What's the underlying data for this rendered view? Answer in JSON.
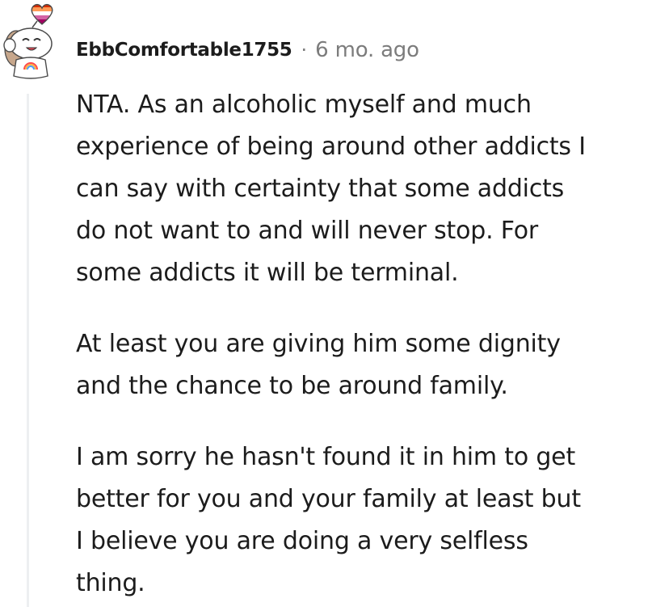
{
  "comment": {
    "author": "EbbComfortable1755",
    "separator": "·",
    "timestamp": "6 mo. ago",
    "paragraphs": [
      [
        "NTA. As an alcoholic myself and much",
        "experience of being around other addicts I",
        "can say with certainty that some addicts",
        "do not want to and will never stop. For",
        "some addicts it will be terminal."
      ],
      [
        "At least you are giving him some dignity",
        "and the chance to be around family."
      ],
      [
        "I am sorry he hasn't found it in him to get",
        "better for you and your family at least but",
        "I believe you are doing a very selfless",
        "thing."
      ]
    ]
  },
  "avatar": {
    "icon": "snoo-avatar-icon",
    "badge_icon": "heart-flag-icon",
    "colors": {
      "face": "#ffffff",
      "outline": "#4a4a4a",
      "hair": "#c7a78c",
      "badge_top": "#d52d00",
      "badge_mid": "#ff9a56",
      "badge_light": "#ffffff",
      "badge_pink": "#d362a4",
      "badge_bottom": "#a30262"
    }
  },
  "colors": {
    "text": "#1c1c1c",
    "meta": "#7c7c7c",
    "thread_line": "#edeff1"
  }
}
